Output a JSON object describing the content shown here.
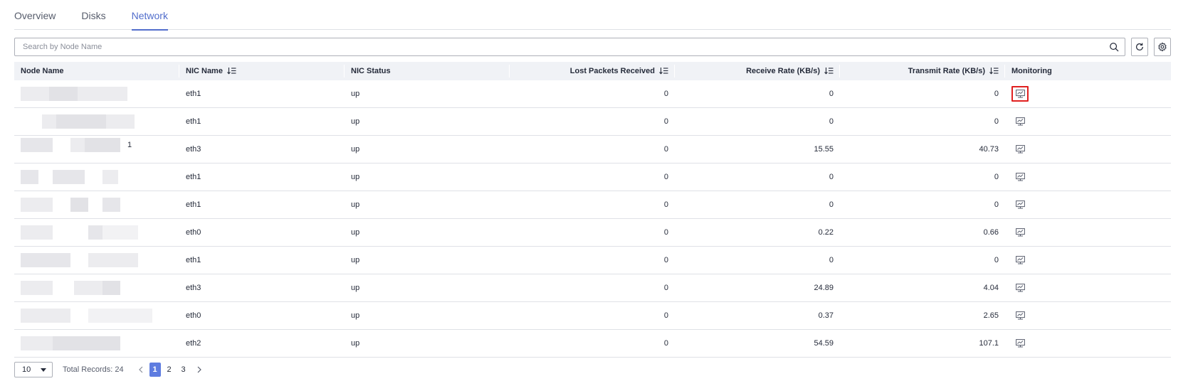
{
  "tabs": [
    {
      "label": "Overview",
      "active": false
    },
    {
      "label": "Disks",
      "active": false
    },
    {
      "label": "Network",
      "active": true
    }
  ],
  "search": {
    "placeholder": "Search by Node Name",
    "value": ""
  },
  "toolbar": {
    "refresh_icon": "refresh-icon",
    "settings_icon": "gear-icon"
  },
  "table": {
    "columns": [
      {
        "label": "Node Name",
        "sortable": false
      },
      {
        "label": "NIC Name",
        "sortable": true
      },
      {
        "label": "NIC Status",
        "sortable": false
      },
      {
        "label": "Lost Packets Received",
        "sortable": true
      },
      {
        "label": "Receive Rate (KB/s)",
        "sortable": true
      },
      {
        "label": "Transmit Rate (KB/s)",
        "sortable": true
      },
      {
        "label": "Monitoring",
        "sortable": false
      }
    ],
    "rows": [
      {
        "node": "",
        "nic": "eth1",
        "status": "up",
        "lost": "0",
        "rx": "0",
        "tx": "0"
      },
      {
        "node": "",
        "nic": "eth1",
        "status": "up",
        "lost": "0",
        "rx": "0",
        "tx": "0"
      },
      {
        "node": "1",
        "nic": "eth3",
        "status": "up",
        "lost": "0",
        "rx": "15.55",
        "tx": "40.73"
      },
      {
        "node": "",
        "nic": "eth1",
        "status": "up",
        "lost": "0",
        "rx": "0",
        "tx": "0"
      },
      {
        "node": "",
        "nic": "eth1",
        "status": "up",
        "lost": "0",
        "rx": "0",
        "tx": "0"
      },
      {
        "node": "",
        "nic": "eth0",
        "status": "up",
        "lost": "0",
        "rx": "0.22",
        "tx": "0.66"
      },
      {
        "node": "",
        "nic": "eth1",
        "status": "up",
        "lost": "0",
        "rx": "0",
        "tx": "0"
      },
      {
        "node": "",
        "nic": "eth3",
        "status": "up",
        "lost": "0",
        "rx": "24.89",
        "tx": "4.04"
      },
      {
        "node": "",
        "nic": "eth0",
        "status": "up",
        "lost": "0",
        "rx": "0.37",
        "tx": "2.65"
      },
      {
        "node": "",
        "nic": "eth2",
        "status": "up",
        "lost": "0",
        "rx": "54.59",
        "tx": "107.1"
      }
    ],
    "monitoring_icon": "monitor-chart-icon"
  },
  "pagination": {
    "page_size": "10",
    "total_label": "Total Records: 24",
    "pages": [
      "1",
      "2",
      "3"
    ],
    "current_page": "1"
  },
  "colors": {
    "accent": "#526ecc",
    "active_page": "#5e7ce0",
    "highlight": "#e02020",
    "header_bg": "#f0f2f6"
  }
}
